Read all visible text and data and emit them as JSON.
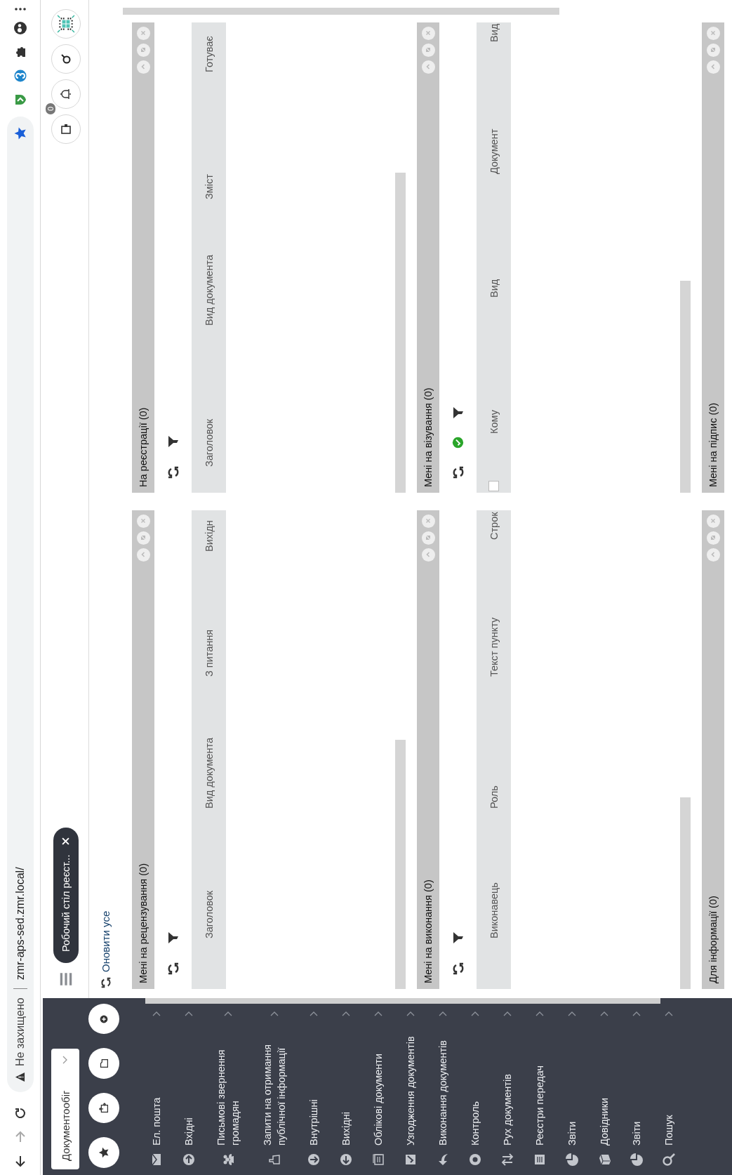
{
  "browser": {
    "security_label": "Не захищено",
    "url": "zmr-aps-sed.zmr.local/"
  },
  "sidebar": {
    "module": "Документообіг",
    "items": [
      {
        "label": "Ел. пошта"
      },
      {
        "label": "Вхідні"
      },
      {
        "label": "Письмові звернення громадян"
      },
      {
        "label": "Запити на отримання публічної інформації"
      },
      {
        "label": "Внутрішні"
      },
      {
        "label": "Вихідні"
      },
      {
        "label": "Облікові документи"
      },
      {
        "label": "Узгодження документів"
      },
      {
        "label": "Виконання документів"
      },
      {
        "label": "Контроль"
      },
      {
        "label": "Рух документів"
      },
      {
        "label": "Реєстри передач"
      },
      {
        "label": "Звіти"
      },
      {
        "label": "Довідники"
      },
      {
        "label": "Звіти"
      },
      {
        "label": "Пошук"
      }
    ]
  },
  "header": {
    "tabs": [
      {
        "label": "Робочий стіл реєст...",
        "selected": true
      }
    ],
    "notification_count": "0"
  },
  "refresh_all": "Оновити усе",
  "panels": [
    {
      "title": "Мені на рецензування (0)",
      "tools": [
        {
          "kind": "refresh"
        },
        {
          "kind": "filter"
        }
      ],
      "columns": [
        {
          "kind": "text",
          "label": "Заголовок"
        },
        {
          "kind": "text",
          "label": "Вид документа"
        },
        {
          "kind": "text",
          "label": "З питання"
        },
        {
          "kind": "text",
          "label": "Вихідн"
        }
      ]
    },
    {
      "title": "На реєстрації (0)",
      "tools": [
        {
          "kind": "refresh"
        },
        {
          "kind": "filter"
        }
      ],
      "columns": [
        {
          "kind": "text",
          "label": "Заголовок"
        },
        {
          "kind": "text",
          "label": "Вид документа"
        },
        {
          "kind": "text",
          "label": "Зміст"
        },
        {
          "kind": "text",
          "label": "Готуває"
        }
      ]
    },
    {
      "title": "Мені на виконання (0)",
      "tools": [
        {
          "kind": "refresh"
        },
        {
          "kind": "filter"
        }
      ],
      "columns": [
        {
          "kind": "text",
          "label": "Виконавець"
        },
        {
          "kind": "text",
          "label": "Роль"
        },
        {
          "kind": "text",
          "label": "Текст пункту"
        },
        {
          "kind": "text",
          "label": "Строк"
        }
      ]
    },
    {
      "title": "Мені на візування (0)",
      "tools": [
        {
          "kind": "refresh"
        },
        {
          "kind": "approve"
        },
        {
          "kind": "filter"
        }
      ],
      "columns": [
        {
          "kind": "checkbox",
          "checked": false
        },
        {
          "kind": "text",
          "label": "Кому"
        },
        {
          "kind": "text",
          "label": "Вид"
        },
        {
          "kind": "text",
          "label": "Документ"
        },
        {
          "kind": "text",
          "label": "Вид"
        }
      ]
    },
    {
      "title": "Для інформації (0)"
    },
    {
      "title": "Мені на підпис (0)"
    }
  ]
}
